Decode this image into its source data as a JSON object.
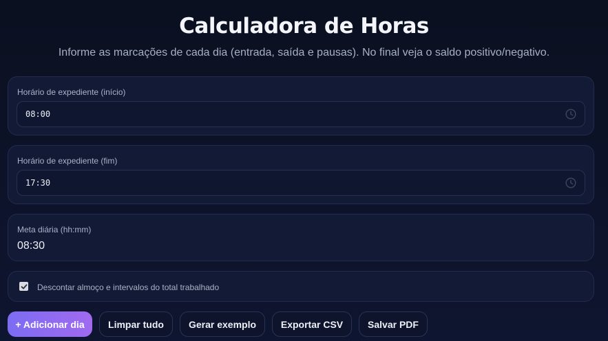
{
  "header": {
    "title": "Calculadora de Horas",
    "subtitle": "Informe as marcações de cada dia (entrada, saída e pausas). No final veja o saldo positivo/negativo."
  },
  "fields": {
    "inicio": {
      "label": "Horário de expediente (início)",
      "value": "08:00"
    },
    "fim": {
      "label": "Horário de expediente (fim)",
      "value": "17:30"
    },
    "meta": {
      "label": "Meta diária (hh:mm)",
      "value": "08:30"
    }
  },
  "options": {
    "descontar_label": "Descontar almoço e intervalos do total trabalhado",
    "descontar_checked": true
  },
  "toolbar": {
    "add_day": "+ Adicionar dia",
    "clear_all": "Limpar tudo",
    "example": "Gerar exemplo",
    "export_csv": "Exportar CSV",
    "save_pdf": "Salvar PDF"
  },
  "icons": {
    "time_picker": "clock-icon",
    "checkbox": "checkmark-icon"
  },
  "colors": {
    "accent_start": "#7c6cf2",
    "accent_end": "#a06af0",
    "background": "#0b1020",
    "card": "#131a36"
  }
}
